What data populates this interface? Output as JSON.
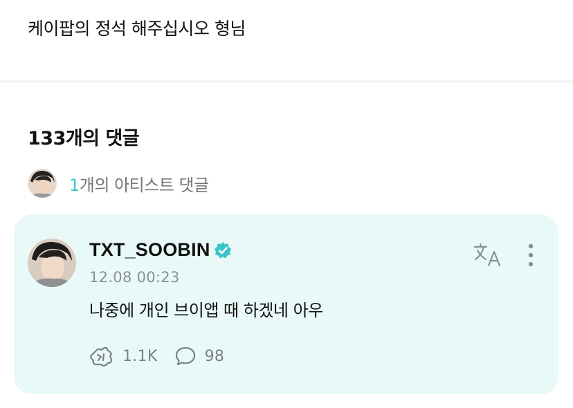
{
  "post": {
    "text": "케이팝의 정석 해주십시오 형님"
  },
  "comments": {
    "count_label": "133개의 댓글",
    "artist_comments": {
      "count": "1",
      "label": "개의 아티스트 댓글"
    }
  },
  "comment": {
    "author": "TXT_SOOBIN",
    "verified": true,
    "timestamp": "12.08 00:23",
    "body": "나중에 개인 브이앱 때 하겠네 아우",
    "likes": "1.1K",
    "replies": "98",
    "card_color": "#e9f9f8",
    "accent_color": "#3cc5c8"
  }
}
